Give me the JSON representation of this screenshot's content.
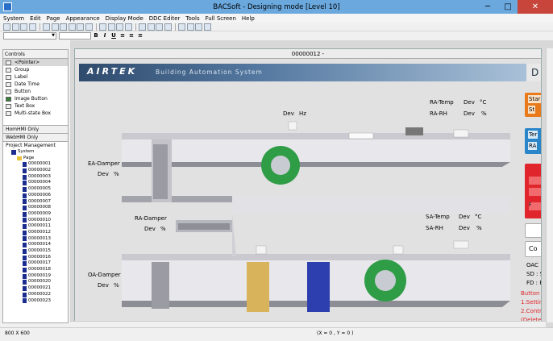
{
  "window": {
    "title": "BACSoft - Designing mode [Level 10]",
    "minimize": "─",
    "maximize": "□",
    "close": "✕"
  },
  "menu": [
    "System",
    "Edit",
    "Page",
    "Appearance",
    "Display Mode",
    "DDC Editer",
    "Tools",
    "Full Screen",
    "Help"
  ],
  "format": {
    "bold": "B",
    "italic": "I",
    "underline": "U"
  },
  "controls": {
    "header": "Controls",
    "items": [
      "<Pointer>",
      "Group",
      "Label",
      "Date Time",
      "Button",
      "Image Button",
      "Text Box",
      "Multi-state Box"
    ]
  },
  "tabs": {
    "hmi_only": "HomHMI Only",
    "web_only": "WebHMI Only",
    "project": "Project Management"
  },
  "tree": {
    "root": "System",
    "page": "Page",
    "pages": [
      "00000001",
      "00000002",
      "00000003",
      "00000004",
      "00000005",
      "00000006",
      "00000007",
      "00000008",
      "00000009",
      "00000010",
      "00000011",
      "00000012",
      "00000013",
      "00000014",
      "00000015",
      "00000016",
      "00000017",
      "00000018",
      "00000019",
      "00000020",
      "00000021",
      "00000022",
      "00000023"
    ]
  },
  "canvas": {
    "title": "00000012 -",
    "brand": "AIRTEK",
    "subtitle": "Building Automation System",
    "banner_right": "D"
  },
  "labels": {
    "dev_hz_dev": "Dev",
    "dev_hz_unit": "Hz",
    "ra_temp": "RA-Temp",
    "ra_temp_dev": "Dev",
    "ra_temp_unit": "°C",
    "ra_rh": "RA-RH",
    "ra_rh_dev": "Dev",
    "ra_rh_unit": "%",
    "ea_damper": "EA-Damper",
    "ea_dev": "Dev",
    "ea_unit": "%",
    "ra_damper": "RA-Damper",
    "ra_d_dev": "Dev",
    "ra_d_unit": "%",
    "sa_temp": "SA-Temp",
    "sa_temp_dev": "Dev",
    "sa_temp_unit": "°C",
    "sa_rh": "SA-RH",
    "sa_rh_dev": "Dev",
    "sa_rh_unit": "%",
    "oa_damper": "OA-Damper",
    "oa_dev": "Dev",
    "oa_unit": "%"
  },
  "right_panel": {
    "start": "Star",
    "start2": "St",
    "temp": "Ter",
    "ra": "RA",
    "co": "Co",
    "oac": "OAC",
    "sd": "SD : S",
    "fd": "FD : F",
    "button": "Button",
    "line1": "1.Settin",
    "line2": "2.Contr",
    "line3": "(Delete",
    "f": "F"
  },
  "colors": {
    "title_bar": "#6aa8de",
    "orange": "#e87a1c",
    "blue": "#2a86c8",
    "red": "#e0262c",
    "fan_green": "#2f9c46"
  },
  "status": {
    "resolution": "800 X 600",
    "coords": "(X = 0 , Y = 0 )"
  }
}
